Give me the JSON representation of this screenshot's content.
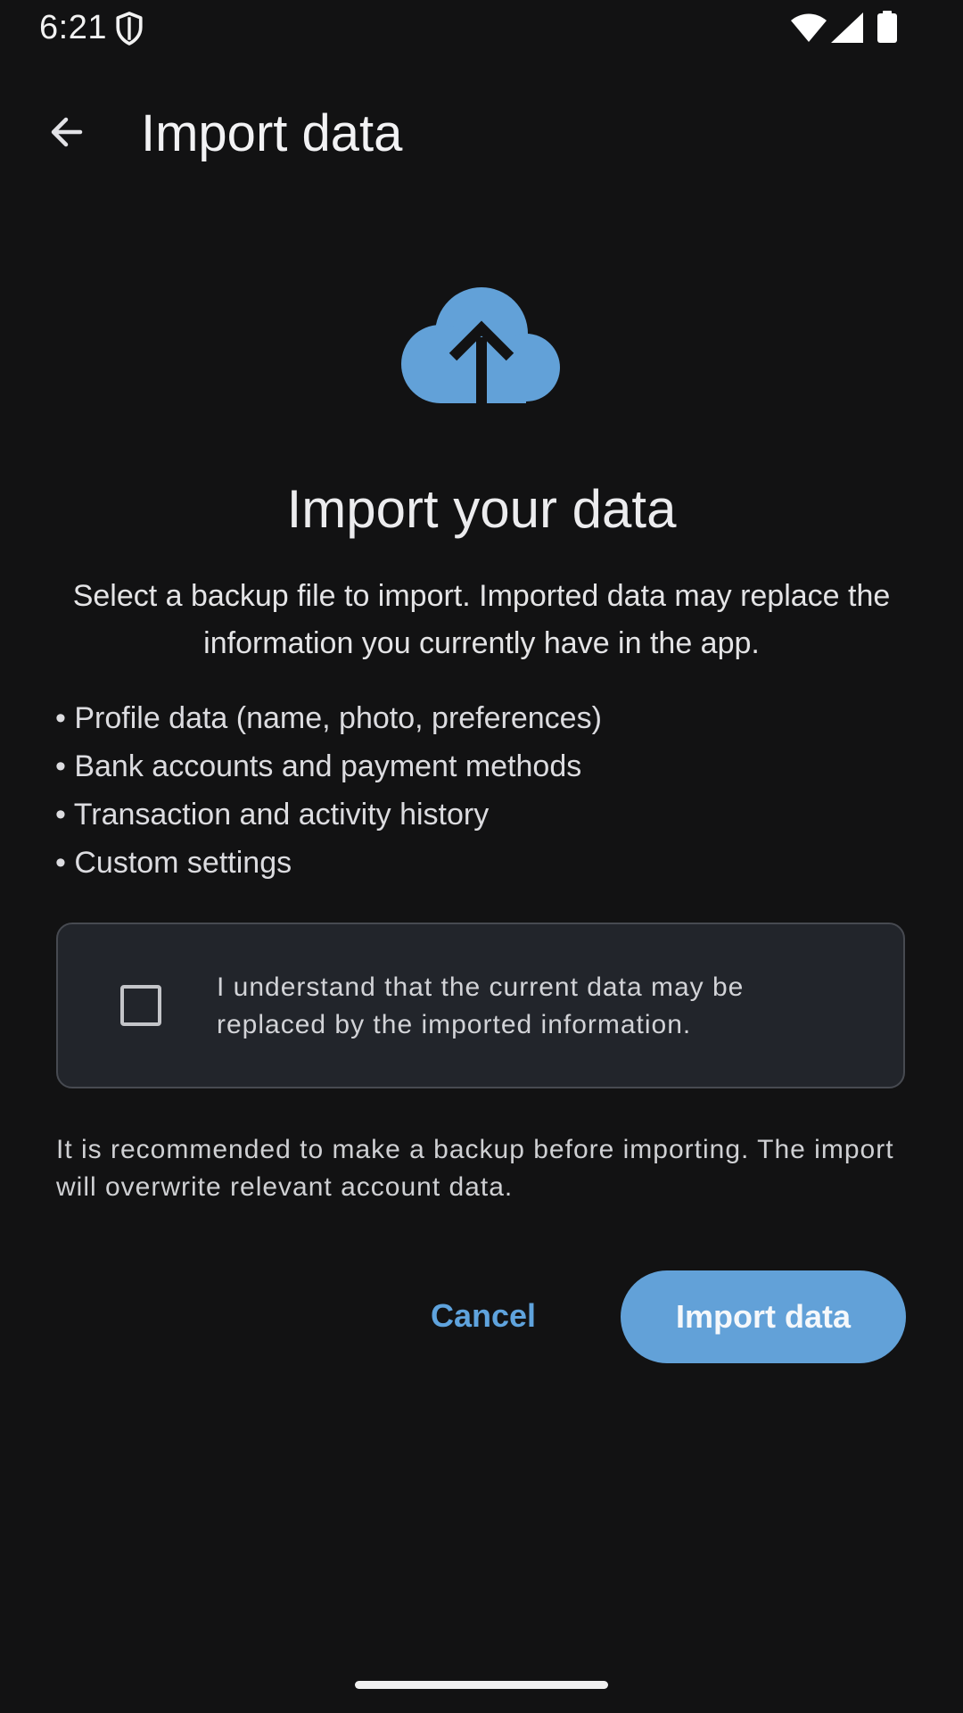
{
  "status_bar": {
    "time": "6:21",
    "icons": [
      "shield-icon",
      "wifi-icon",
      "signal-icon",
      "battery-icon"
    ]
  },
  "app_bar": {
    "back_icon": "arrow-back-icon",
    "title": "Import data"
  },
  "hero": {
    "icon": "cloud-upload-icon",
    "heading": "Import your data",
    "description": "Select a backup file to import. Imported data may replace the information you currently have in the app."
  },
  "bullets": [
    "• Profile data (name, photo, preferences)",
    "• Bank accounts and payment methods",
    "• Transaction and activity history",
    "• Custom settings"
  ],
  "consent": {
    "checked": false,
    "label": "I understand that the current data may be replaced by the imported information."
  },
  "note": "It is recommended to make a backup before importing. The import will overwrite relevant account data.",
  "actions": {
    "cancel_label": "Cancel",
    "import_label": "Import data"
  },
  "colors": {
    "background": "#121213",
    "accent": "#62a1d8",
    "accent_text": "#5fa3dd",
    "card_background": "#22252b",
    "card_border": "#474a51"
  }
}
